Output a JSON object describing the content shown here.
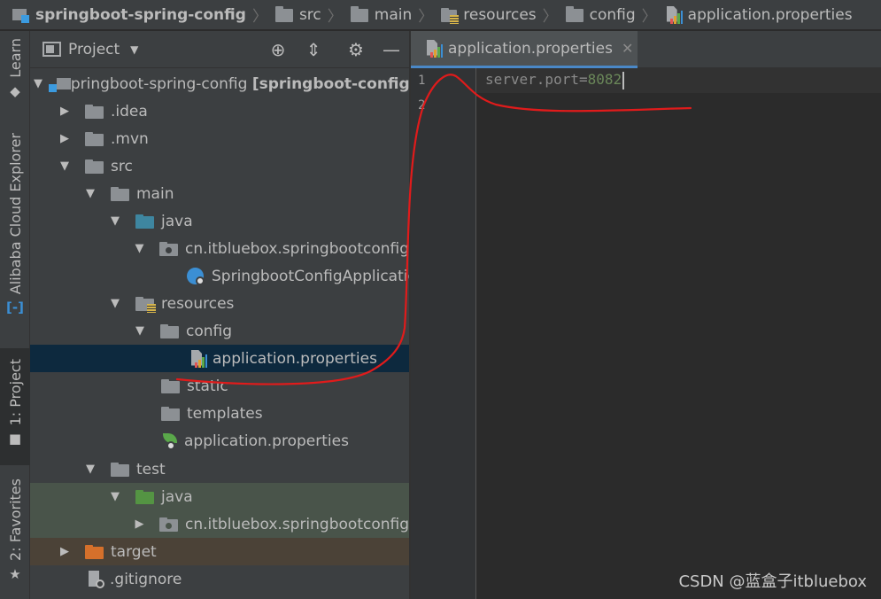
{
  "breadcrumb": {
    "items": [
      {
        "label": "springboot-spring-config",
        "icon": "module-icon"
      },
      {
        "label": "src",
        "icon": "folder-icon"
      },
      {
        "label": "main",
        "icon": "folder-icon"
      },
      {
        "label": "resources",
        "icon": "resources-folder-icon"
      },
      {
        "label": "config",
        "icon": "folder-icon"
      },
      {
        "label": "application.properties",
        "icon": "properties-file-icon"
      }
    ]
  },
  "toolstrip": {
    "learn": "Learn",
    "alibaba": "Alibaba Cloud Explorer",
    "project": "1: Project",
    "favorites": "2: Favorites"
  },
  "panel": {
    "title": "Project"
  },
  "tree": [
    {
      "label": "springboot-spring-config",
      "suffix": "[springboot-config",
      "type": "module"
    },
    {
      "label": ".idea",
      "type": "folder"
    },
    {
      "label": ".mvn",
      "type": "folder"
    },
    {
      "label": "src",
      "type": "folder"
    },
    {
      "label": "main",
      "type": "folder"
    },
    {
      "label": "java",
      "type": "source-folder"
    },
    {
      "label": "cn.itbluebox.springbootconfig",
      "type": "package"
    },
    {
      "label": "SpringbootConfigApplicatio",
      "type": "spring-class"
    },
    {
      "label": "resources",
      "type": "resources-folder"
    },
    {
      "label": "config",
      "type": "folder"
    },
    {
      "label": "application.properties",
      "type": "properties-file"
    },
    {
      "label": "static",
      "type": "folder"
    },
    {
      "label": "templates",
      "type": "folder"
    },
    {
      "label": "application.properties",
      "type": "spring-properties-file"
    },
    {
      "label": "test",
      "type": "folder"
    },
    {
      "label": "java",
      "type": "test-folder"
    },
    {
      "label": "cn.itbluebox.springbootconfig",
      "type": "package"
    },
    {
      "label": "target",
      "type": "excluded-folder"
    },
    {
      "label": ".gitignore",
      "type": "ignore-file"
    }
  ],
  "editor": {
    "tab_label": "application.properties",
    "line_numbers": [
      "1",
      "2"
    ],
    "code_key": "server.port=",
    "code_value": "8082"
  },
  "watermark": "CSDN @蓝盒子itbluebox",
  "colors": {
    "selection": "#0d293e",
    "test_row": "#49544a",
    "excluded_row": "#4b4237",
    "annotation": "#e01b1b",
    "tab_underline": "#4a88c7"
  }
}
